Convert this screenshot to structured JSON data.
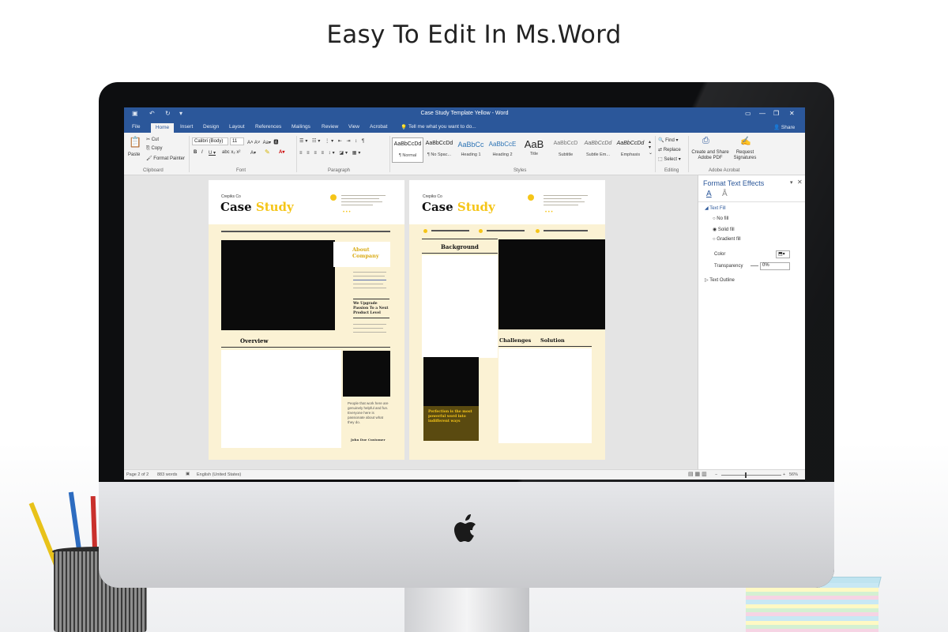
{
  "headline": "Easy To Edit In Ms.Word",
  "window": {
    "title": "Case Study Template Yellow  -  Word",
    "tabs": [
      "File",
      "Home",
      "Insert",
      "Design",
      "Layout",
      "References",
      "Mailings",
      "Review",
      "View",
      "Acrobat"
    ],
    "tell_me": "Tell me what you want to do...",
    "share": "Share"
  },
  "ribbon": {
    "clipboard": {
      "paste": "Paste",
      "cut": "Cut",
      "copy": "Copy",
      "format_painter": "Format Painter",
      "group": "Clipboard"
    },
    "font": {
      "name": "Calibri (Body)",
      "size": "11",
      "group": "Font"
    },
    "paragraph": {
      "group": "Paragraph"
    },
    "styles": {
      "group": "Styles",
      "items": [
        {
          "preview": "AaBbCcDd",
          "name": "¶ Normal"
        },
        {
          "preview": "AaBbCcDd",
          "name": "¶ No Spac..."
        },
        {
          "preview": "AaBbCc",
          "name": "Heading 1"
        },
        {
          "preview": "AaBbCcE",
          "name": "Heading 2"
        },
        {
          "preview": "AaB",
          "name": "Title"
        },
        {
          "preview": "AaBbCcD",
          "name": "Subtitle"
        },
        {
          "preview": "AaBbCcDd",
          "name": "Subtle Em..."
        },
        {
          "preview": "AaBbCcDd",
          "name": "Emphasis"
        }
      ]
    },
    "editing": {
      "find": "Find",
      "replace": "Replace",
      "select": "Select",
      "group": "Editing"
    },
    "acrobat": {
      "create": "Create and Share Adobe PDF",
      "request": "Request Signatures",
      "group": "Adobe Acrobat"
    }
  },
  "pane": {
    "title": "Format Text Effects",
    "text_fill": "Text Fill",
    "options": [
      "No fill",
      "Solid fill",
      "Gradient fill"
    ],
    "selected_option": "Solid fill",
    "color_label": "Color",
    "transparency_label": "Transparency",
    "transparency_value": "0%",
    "text_outline": "Text Outline"
  },
  "page1": {
    "brand": "Crepiks Co",
    "title_main": "Case",
    "title_accent": "Study",
    "about": "About Company",
    "upgrade": "We Upgrade Passion To a Next Product Level",
    "overview": "Overview",
    "quote": "People that work here are genuinely helpful and fun. Everyone here is passionate about what they do.",
    "quote_author": "John Doe Customer"
  },
  "page2": {
    "brand": "Crepiks Co",
    "title_main": "Case",
    "title_accent": "Study",
    "background": "Background",
    "challenges": "Challenges",
    "solution": "Solution",
    "callout": "Perfection is the most powerful word into indifferent ways"
  },
  "status": {
    "page": "Page 2 of 2",
    "words": "883 words",
    "language": "English (United States)",
    "zoom": "56%"
  },
  "colors": {
    "word_blue": "#2b579a",
    "accent_yellow": "#f5c518",
    "cream": "#fbf2d4",
    "olive": "#5a4a10"
  }
}
